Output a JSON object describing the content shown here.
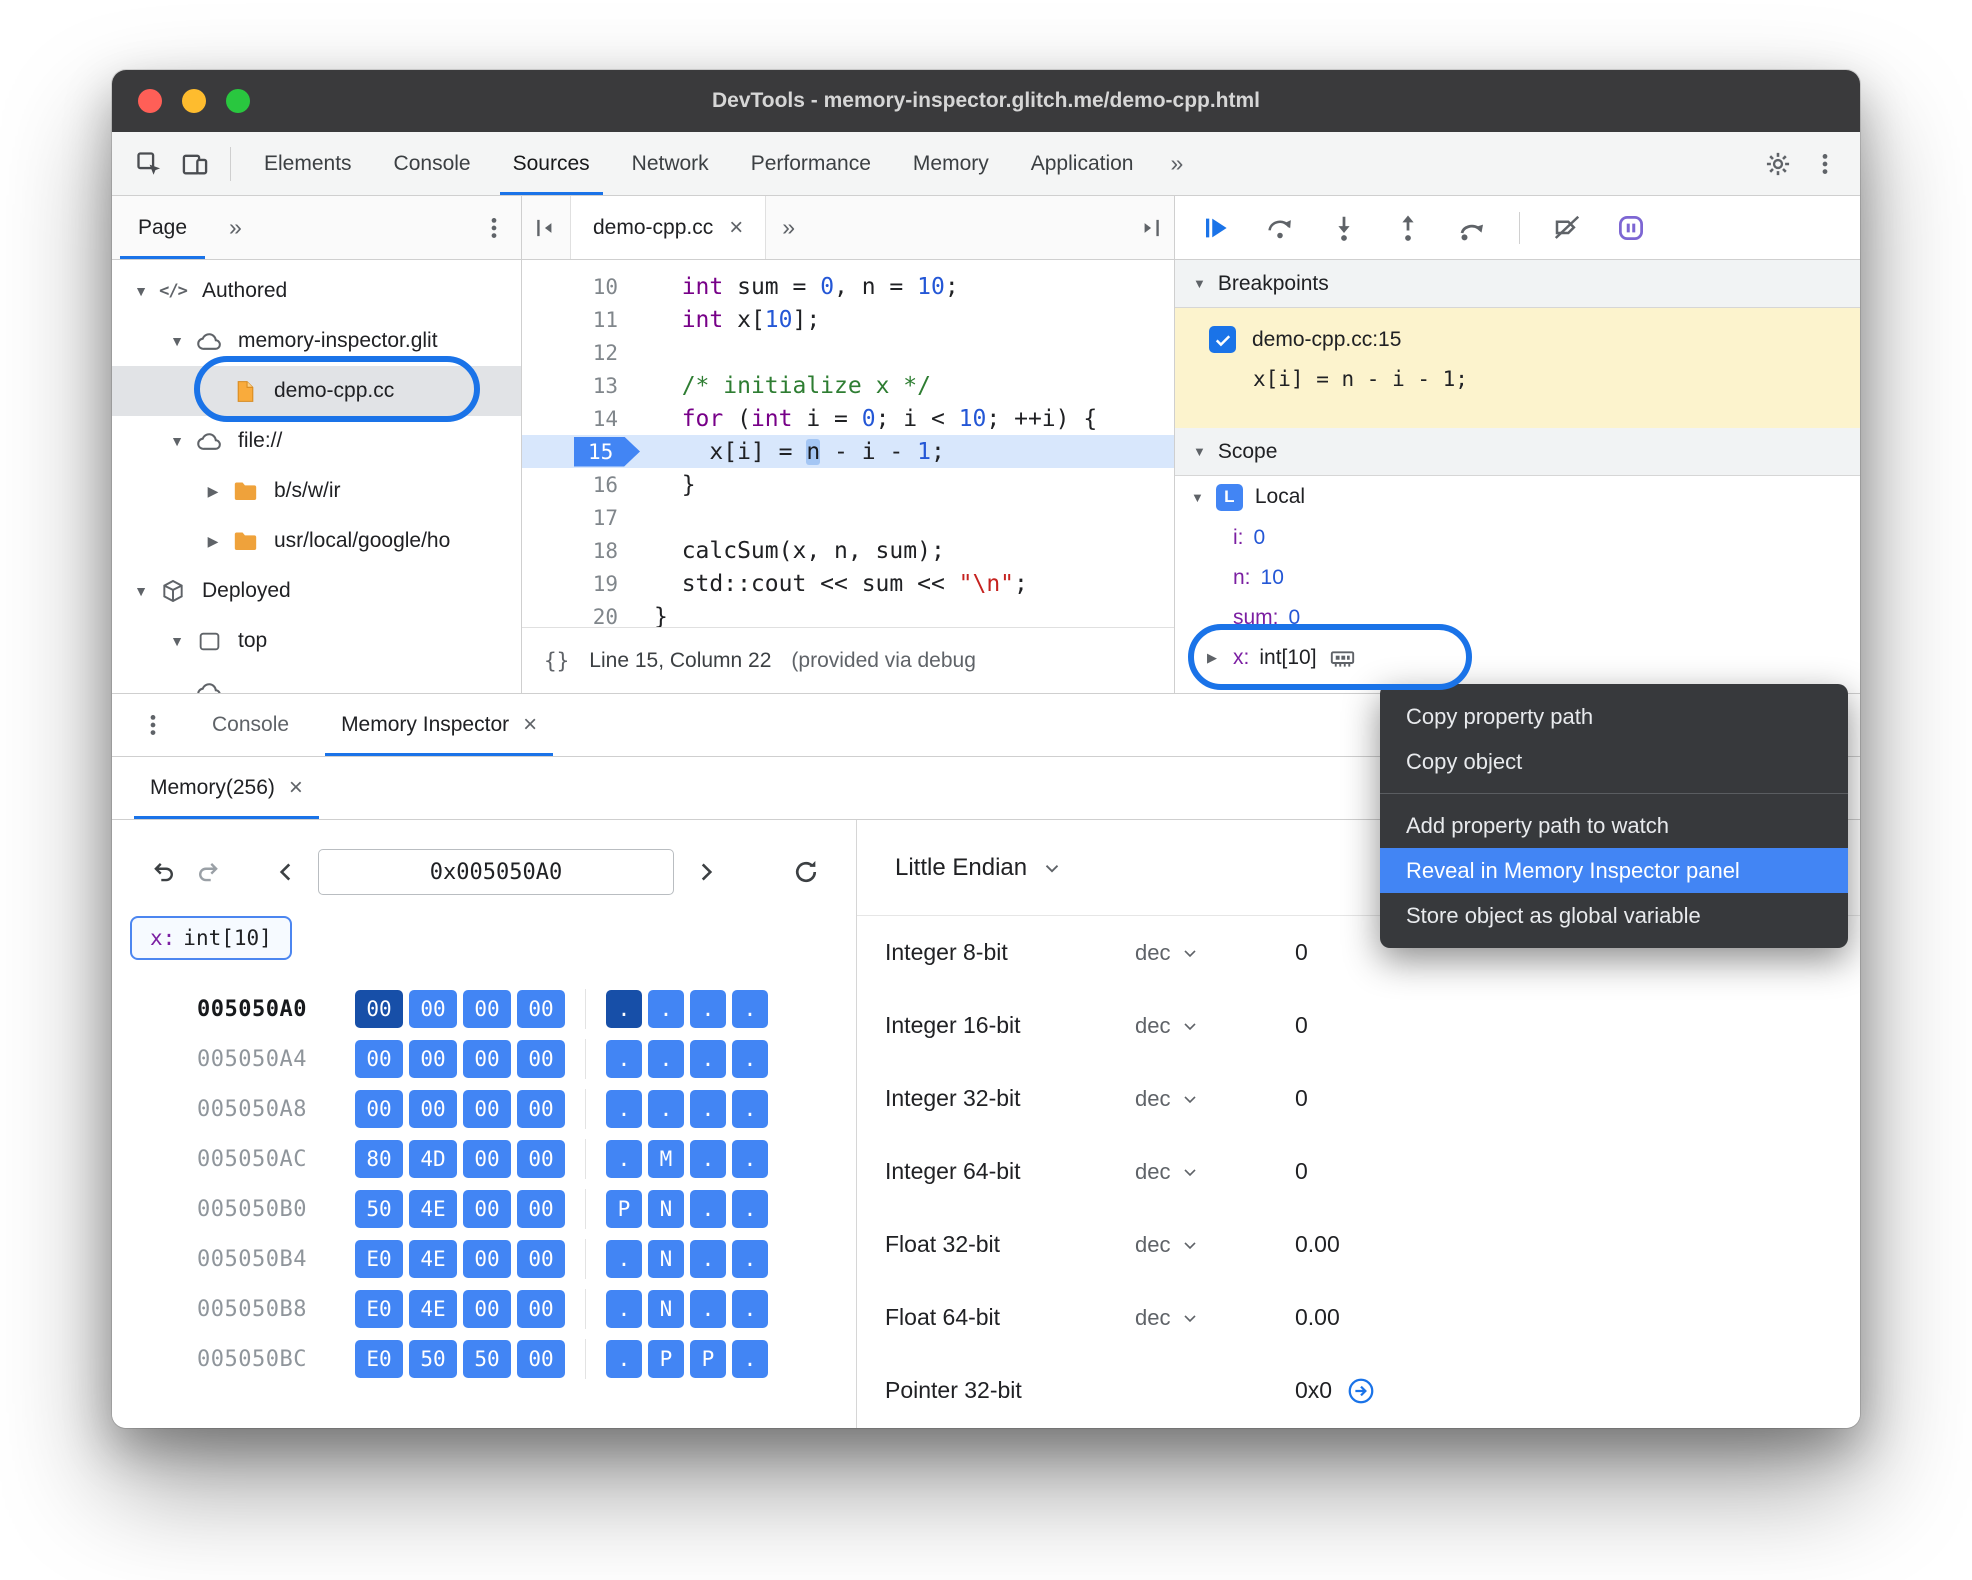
{
  "window": {
    "title": "DevTools - memory-inspector.glitch.me/demo-cpp.html"
  },
  "colors": {
    "accent": "#1a73e8",
    "chip_blue": "#4285f4",
    "chip_selected": "#174fa8",
    "breakpoint_bg": "#fcf3cd",
    "menu_highlight": "#4285f4",
    "annotation": "#1a73e8"
  },
  "icons": {
    "triangle_down": "▼",
    "triangle_right": "▶",
    "vdots": "⋮",
    "more": "»",
    "close": "×"
  },
  "main_toolbar": {
    "tabs": [
      {
        "id": "elements",
        "label": "Elements",
        "selected": false
      },
      {
        "id": "console",
        "label": "Console",
        "selected": false
      },
      {
        "id": "sources",
        "label": "Sources",
        "selected": true
      },
      {
        "id": "network",
        "label": "Network",
        "selected": false
      },
      {
        "id": "performance",
        "label": "Performance",
        "selected": false
      },
      {
        "id": "memory",
        "label": "Memory",
        "selected": false
      },
      {
        "id": "application",
        "label": "Application",
        "selected": false
      }
    ],
    "more_label": "»"
  },
  "navigator": {
    "tab_label": "Page",
    "more_label": "»",
    "tree": [
      {
        "id": "authored",
        "depth": 0,
        "expander": "▼",
        "icon": "code",
        "label": "Authored"
      },
      {
        "id": "memory-inspector-glitch",
        "depth": 1,
        "expander": "▼",
        "icon": "cloud",
        "label": "memory-inspector.glit"
      },
      {
        "id": "demo-cpp-cc",
        "depth": 2,
        "expander": "",
        "icon": "file",
        "label": "demo-cpp.cc",
        "selected": true
      },
      {
        "id": "file-scheme",
        "depth": 1,
        "expander": "▼",
        "icon": "cloud",
        "label": "file://"
      },
      {
        "id": "b-s-w-ir",
        "depth": 2,
        "expander": "▶",
        "icon": "folder",
        "label": "b/s/w/ir"
      },
      {
        "id": "usr-local-google",
        "depth": 2,
        "expander": "▶",
        "icon": "folder",
        "label": "usr/local/google/ho"
      },
      {
        "id": "deployed",
        "depth": 0,
        "expander": "▼",
        "icon": "package",
        "label": "Deployed"
      },
      {
        "id": "top",
        "depth": 1,
        "expander": "▼",
        "icon": "frame",
        "label": "top"
      },
      {
        "id": "partial-item",
        "depth": 1,
        "expander": "",
        "icon": "cloud",
        "label": "",
        "partial": true
      }
    ]
  },
  "editor": {
    "tab": {
      "label": "demo-cpp.cc",
      "close": "×"
    },
    "more_label": "»",
    "lines": [
      {
        "no": 10,
        "segs": [
          [
            "pl",
            "  "
          ],
          [
            "kw",
            "int"
          ],
          [
            "pl",
            " sum = "
          ],
          [
            "num",
            "0"
          ],
          [
            "pl",
            ", n = "
          ],
          [
            "num",
            "10"
          ],
          [
            "pl",
            ";"
          ]
        ]
      },
      {
        "no": 11,
        "segs": [
          [
            "pl",
            "  "
          ],
          [
            "kw",
            "int"
          ],
          [
            "pl",
            " x["
          ],
          [
            "num",
            "10"
          ],
          [
            "pl",
            "];"
          ]
        ]
      },
      {
        "no": 12,
        "segs": []
      },
      {
        "no": 13,
        "segs": [
          [
            "pl",
            "  "
          ],
          [
            "cm",
            "/* initialize x */"
          ]
        ]
      },
      {
        "no": 14,
        "segs": [
          [
            "pl",
            "  "
          ],
          [
            "kw",
            "for"
          ],
          [
            "pl",
            " ("
          ],
          [
            "kw",
            "int"
          ],
          [
            "pl",
            " i = "
          ],
          [
            "num",
            "0"
          ],
          [
            "pl",
            "; i < "
          ],
          [
            "num",
            "10"
          ],
          [
            "pl",
            "; ++i) {"
          ]
        ]
      },
      {
        "no": 15,
        "current": true,
        "segs": [
          [
            "pl",
            "    "
          ],
          [
            "pl",
            "x[i] = "
          ],
          [
            "hl",
            "n"
          ],
          [
            "pl",
            " - i - "
          ],
          [
            "num",
            "1"
          ],
          [
            "pl",
            ";"
          ]
        ]
      },
      {
        "no": 16,
        "segs": [
          [
            "pl",
            "  }"
          ]
        ]
      },
      {
        "no": 17,
        "segs": []
      },
      {
        "no": 18,
        "segs": [
          [
            "pl",
            "  calcSum(x, n, sum);"
          ]
        ]
      },
      {
        "no": 19,
        "segs": [
          [
            "pl",
            "  std::cout << sum << "
          ],
          [
            "str",
            "\"\\n\""
          ],
          [
            "pl",
            ";"
          ]
        ]
      },
      {
        "no": 20,
        "segs": [
          [
            "pl",
            "}"
          ]
        ]
      }
    ],
    "status": {
      "braces": "{}",
      "position": "Line 15, Column 22",
      "note": "(provided via debug"
    }
  },
  "debugger": {
    "controls": [
      {
        "id": "resume"
      },
      {
        "id": "step-over"
      },
      {
        "id": "step-into"
      },
      {
        "id": "step-out"
      },
      {
        "id": "step"
      },
      {
        "divider": true
      },
      {
        "id": "deactivate-breakpoints"
      },
      {
        "id": "pause-on-exceptions"
      }
    ],
    "breakpoints": {
      "title": "Breakpoints",
      "items": [
        {
          "checked": true,
          "location": "demo-cpp.cc:15",
          "snippet": "x[i] = n - i - 1;"
        }
      ]
    },
    "scope": {
      "title": "Scope",
      "groups": [
        {
          "badge": "L",
          "label": "Local",
          "vars": [
            {
              "name": "i",
              "value": "0",
              "kind": "number"
            },
            {
              "name": "n",
              "value": "10",
              "kind": "number"
            },
            {
              "name": "sum",
              "value": "0",
              "kind": "number"
            },
            {
              "name": "x",
              "value": "int[10]",
              "kind": "object",
              "expander": true,
              "memory_icon": true,
              "annotated": true
            }
          ]
        }
      ]
    }
  },
  "context_menu": {
    "items": [
      {
        "label": "Copy property path"
      },
      {
        "label": "Copy object"
      },
      {
        "divider": true
      },
      {
        "label": "Add property path to watch"
      },
      {
        "label": "Reveal in Memory Inspector panel",
        "highlighted": true
      },
      {
        "label": "Store object as global variable"
      }
    ]
  },
  "drawer": {
    "tabs": [
      {
        "id": "console",
        "label": "Console",
        "selected": false
      },
      {
        "id": "memory-inspector",
        "label": "Memory Inspector",
        "close": "×",
        "selected": true
      }
    ],
    "memory_inspector": {
      "tab": {
        "label": "Memory(256)",
        "close": "×"
      },
      "address_input": "0x005050A0",
      "tag": {
        "name": "x:",
        "value": "int[10]"
      },
      "rows": [
        {
          "address": "005050A0",
          "bytes": [
            "00",
            "00",
            "00",
            "00"
          ],
          "ascii": [
            ".",
            ".",
            ".",
            "."
          ],
          "selected": true,
          "selected_byte": 0
        },
        {
          "address": "005050A4",
          "bytes": [
            "00",
            "00",
            "00",
            "00"
          ],
          "ascii": [
            ".",
            ".",
            ".",
            "."
          ]
        },
        {
          "address": "005050A8",
          "bytes": [
            "00",
            "00",
            "00",
            "00"
          ],
          "ascii": [
            ".",
            ".",
            ".",
            "."
          ]
        },
        {
          "address": "005050AC",
          "bytes": [
            "80",
            "4D",
            "00",
            "00"
          ],
          "ascii": [
            ".",
            "M",
            ".",
            "."
          ]
        },
        {
          "address": "005050B0",
          "bytes": [
            "50",
            "4E",
            "00",
            "00"
          ],
          "ascii": [
            "P",
            "N",
            ".",
            "."
          ]
        },
        {
          "address": "005050B4",
          "bytes": [
            "E0",
            "4E",
            "00",
            "00"
          ],
          "ascii": [
            ".",
            "N",
            ".",
            "."
          ]
        },
        {
          "address": "005050B8",
          "bytes": [
            "E0",
            "4E",
            "00",
            "00"
          ],
          "ascii": [
            ".",
            "N",
            ".",
            "."
          ]
        },
        {
          "address": "005050BC",
          "bytes": [
            "E0",
            "50",
            "50",
            "00"
          ],
          "ascii": [
            ".",
            "P",
            "P",
            "."
          ]
        }
      ],
      "endianness": "Little Endian",
      "interpreter": [
        {
          "label": "Integer 8-bit",
          "mode": "dec",
          "value": "0"
        },
        {
          "label": "Integer 16-bit",
          "mode": "dec",
          "value": "0"
        },
        {
          "label": "Integer 32-bit",
          "mode": "dec",
          "value": "0"
        },
        {
          "label": "Integer 64-bit",
          "mode": "dec",
          "value": "0"
        },
        {
          "label": "Float 32-bit",
          "mode": "dec",
          "value": "0.00"
        },
        {
          "label": "Float 64-bit",
          "mode": "dec",
          "value": "0.00"
        },
        {
          "label": "Pointer 32-bit",
          "mode": null,
          "value": "0x0",
          "link": true
        }
      ]
    }
  }
}
